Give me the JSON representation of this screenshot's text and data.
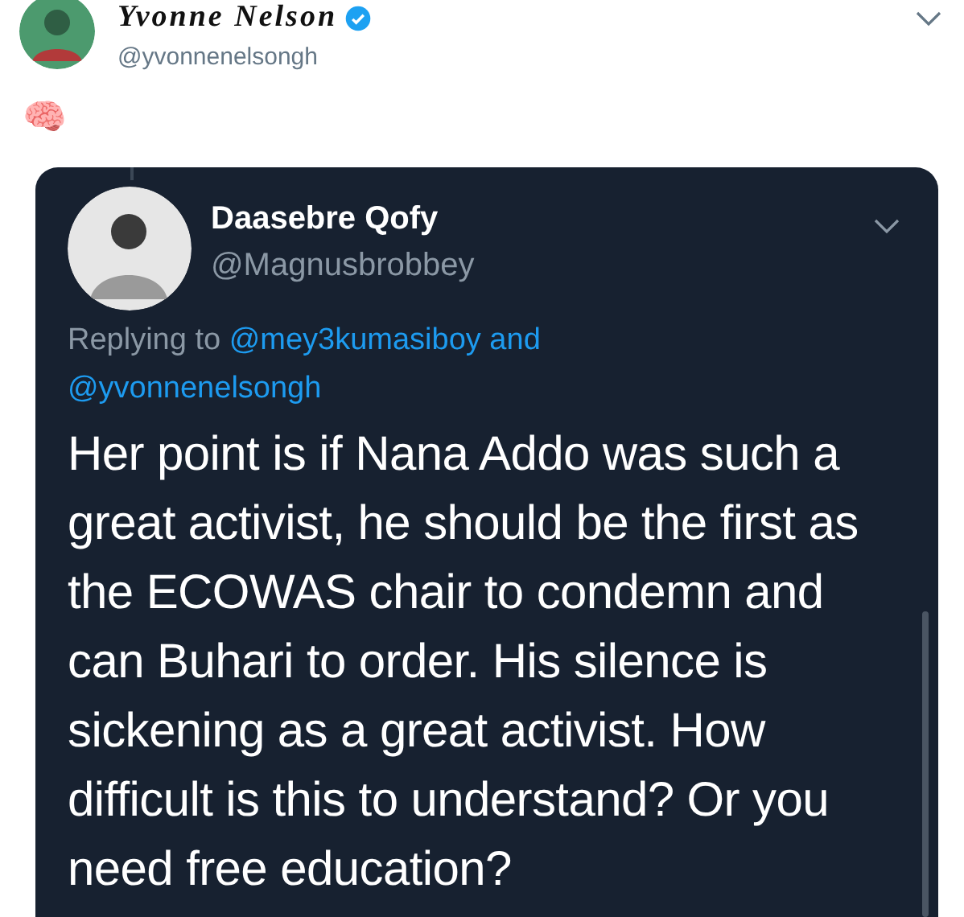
{
  "tweet": {
    "author_name": "Yvonne Nelson",
    "verified": true,
    "handle": "@yvonnenelsongh",
    "body": "🧠",
    "quoted": {
      "author_name": "Daasebre Qofy",
      "handle": "@Magnusbrobbey",
      "replying_prefix": "Replying to",
      "replying_targets": "@mey3kumasiboy and @yvonnenelsongh",
      "text": "Her point is if Nana Addo was such a great activist, he should be the first as the ECOWAS chair to condemn and can Buhari to order. His silence is sickening as a great activist. How difficult is this to understand? Or you need free education?"
    }
  }
}
